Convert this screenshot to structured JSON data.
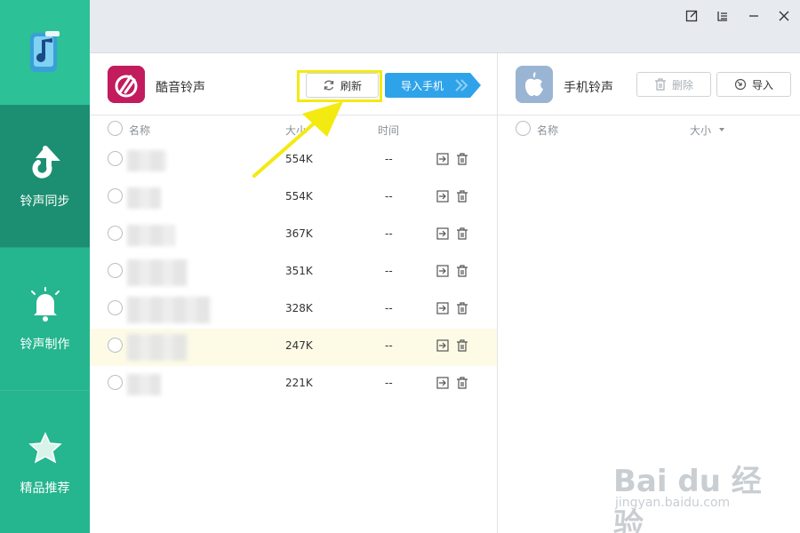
{
  "sidebar": {
    "items": [
      {
        "label": "铃声同步",
        "icon": "sync-arrow-icon",
        "active": true
      },
      {
        "label": "铃声制作",
        "icon": "bell-icon",
        "active": false
      },
      {
        "label": "精品推荐",
        "icon": "star-icon",
        "active": false
      }
    ]
  },
  "window": {
    "controls": [
      "edit-icon",
      "menu-icon",
      "minimize-icon",
      "close-icon"
    ]
  },
  "left_panel": {
    "title": "酷音铃声",
    "refresh_label": "刷新",
    "import_label": "导入手机",
    "columns": {
      "name": "名称",
      "size": "大小",
      "time": "时间"
    },
    "rows": [
      {
        "size": "554K",
        "time": "--"
      },
      {
        "size": "554K",
        "time": "--"
      },
      {
        "size": "367K",
        "time": "--"
      },
      {
        "size": "351K",
        "time": "--"
      },
      {
        "size": "328K",
        "time": "--"
      },
      {
        "size": "247K",
        "time": "--",
        "selected": true
      },
      {
        "size": "221K",
        "time": "--"
      }
    ]
  },
  "right_panel": {
    "title": "手机铃声",
    "delete_label": "删除",
    "import_label": "导入",
    "columns": {
      "name": "名称",
      "size": "大小"
    }
  },
  "watermark": {
    "main": "Bai du 经验",
    "sub": "jingyan.baidu.com"
  },
  "colors": {
    "sidebar": "#25b58f",
    "sidebar_active": "#1c8f72",
    "primary_button": "#2fa3ea",
    "highlight": "#f3ea12"
  }
}
